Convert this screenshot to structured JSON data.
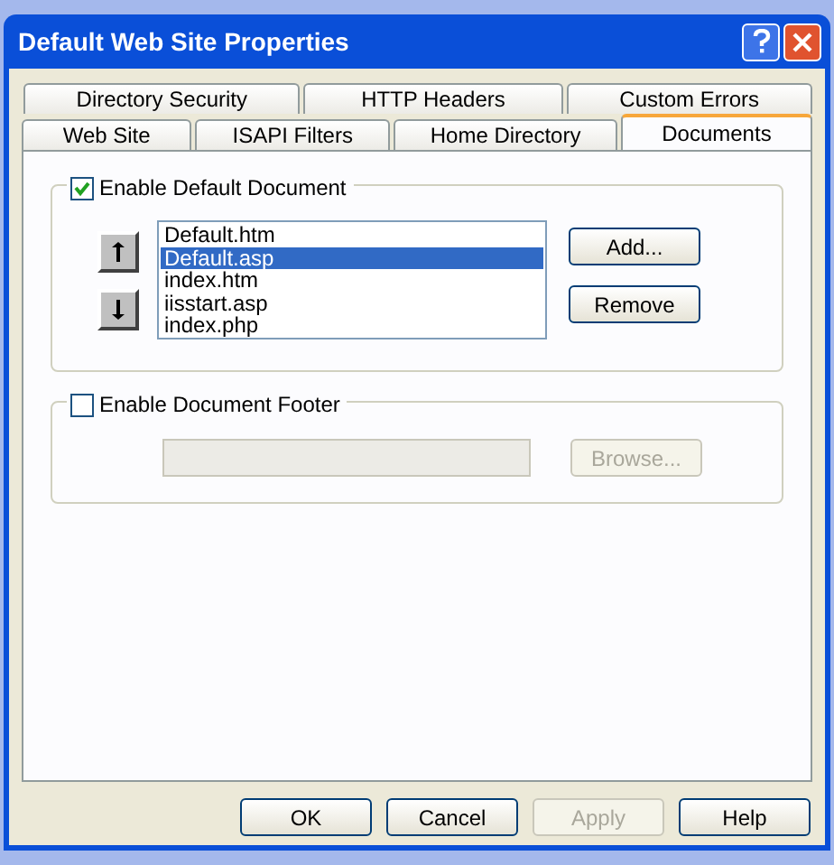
{
  "window": {
    "title": "Default Web Site Properties"
  },
  "tab_rows": [
    [
      {
        "label": "Directory Security",
        "selected": false
      },
      {
        "label": "HTTP Headers",
        "selected": false
      },
      {
        "label": "Custom Errors",
        "selected": false
      }
    ],
    [
      {
        "label": "Web Site",
        "selected": false
      },
      {
        "label": "ISAPI Filters",
        "selected": false
      },
      {
        "label": "Home Directory",
        "selected": false
      },
      {
        "label": "Documents",
        "selected": true
      }
    ]
  ],
  "default_document": {
    "label": "Enable Default Document",
    "checked": true,
    "documents": [
      {
        "name": "Default.htm",
        "selected": false
      },
      {
        "name": "Default.asp",
        "selected": true
      },
      {
        "name": "index.htm",
        "selected": false
      },
      {
        "name": "iisstart.asp",
        "selected": false
      },
      {
        "name": "index.php",
        "selected": false
      }
    ],
    "buttons": [
      {
        "label": "Add...",
        "disabled": false
      },
      {
        "label": "Remove",
        "disabled": false
      }
    ]
  },
  "document_footer": {
    "label": "Enable Document Footer",
    "checked": false,
    "browse": {
      "label": "Browse...",
      "disabled": true
    }
  },
  "buttons": [
    {
      "label": "OK",
      "disabled": false
    },
    {
      "label": "Cancel",
      "disabled": false
    },
    {
      "label": "Apply",
      "disabled": true
    },
    {
      "label": "Help",
      "disabled": false
    }
  ]
}
